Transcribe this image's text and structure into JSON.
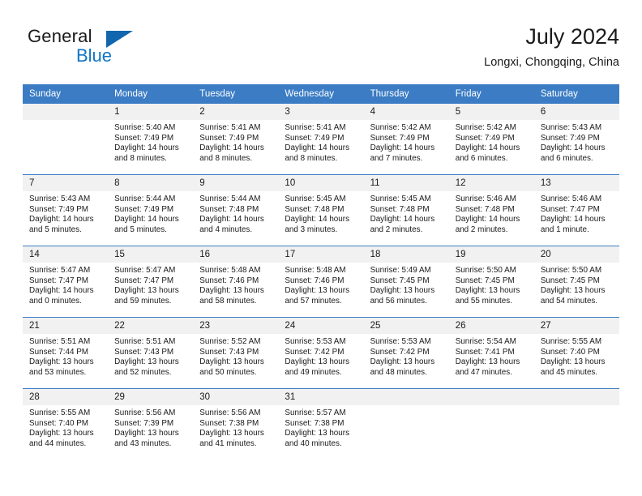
{
  "brand": {
    "name_part1": "General",
    "name_part2": "Blue",
    "triangle_icon": "triangle-icon",
    "accent_color": "#1166ad"
  },
  "header": {
    "title": "July 2024",
    "location": "Longxi, Chongqing, China",
    "header_bg_color": "#3b7cc4",
    "daynum_bg_color": "#f1f1f1"
  },
  "weekday_headers": [
    "Sunday",
    "Monday",
    "Tuesday",
    "Wednesday",
    "Thursday",
    "Friday",
    "Saturday"
  ],
  "weeks": [
    [
      {
        "day": "",
        "sunrise": "",
        "sunset": "",
        "daylight": ""
      },
      {
        "day": "1",
        "sunrise": "Sunrise: 5:40 AM",
        "sunset": "Sunset: 7:49 PM",
        "daylight": "Daylight: 14 hours and 8 minutes."
      },
      {
        "day": "2",
        "sunrise": "Sunrise: 5:41 AM",
        "sunset": "Sunset: 7:49 PM",
        "daylight": "Daylight: 14 hours and 8 minutes."
      },
      {
        "day": "3",
        "sunrise": "Sunrise: 5:41 AM",
        "sunset": "Sunset: 7:49 PM",
        "daylight": "Daylight: 14 hours and 8 minutes."
      },
      {
        "day": "4",
        "sunrise": "Sunrise: 5:42 AM",
        "sunset": "Sunset: 7:49 PM",
        "daylight": "Daylight: 14 hours and 7 minutes."
      },
      {
        "day": "5",
        "sunrise": "Sunrise: 5:42 AM",
        "sunset": "Sunset: 7:49 PM",
        "daylight": "Daylight: 14 hours and 6 minutes."
      },
      {
        "day": "6",
        "sunrise": "Sunrise: 5:43 AM",
        "sunset": "Sunset: 7:49 PM",
        "daylight": "Daylight: 14 hours and 6 minutes."
      }
    ],
    [
      {
        "day": "7",
        "sunrise": "Sunrise: 5:43 AM",
        "sunset": "Sunset: 7:49 PM",
        "daylight": "Daylight: 14 hours and 5 minutes."
      },
      {
        "day": "8",
        "sunrise": "Sunrise: 5:44 AM",
        "sunset": "Sunset: 7:49 PM",
        "daylight": "Daylight: 14 hours and 5 minutes."
      },
      {
        "day": "9",
        "sunrise": "Sunrise: 5:44 AM",
        "sunset": "Sunset: 7:48 PM",
        "daylight": "Daylight: 14 hours and 4 minutes."
      },
      {
        "day": "10",
        "sunrise": "Sunrise: 5:45 AM",
        "sunset": "Sunset: 7:48 PM",
        "daylight": "Daylight: 14 hours and 3 minutes."
      },
      {
        "day": "11",
        "sunrise": "Sunrise: 5:45 AM",
        "sunset": "Sunset: 7:48 PM",
        "daylight": "Daylight: 14 hours and 2 minutes."
      },
      {
        "day": "12",
        "sunrise": "Sunrise: 5:46 AM",
        "sunset": "Sunset: 7:48 PM",
        "daylight": "Daylight: 14 hours and 2 minutes."
      },
      {
        "day": "13",
        "sunrise": "Sunrise: 5:46 AM",
        "sunset": "Sunset: 7:47 PM",
        "daylight": "Daylight: 14 hours and 1 minute."
      }
    ],
    [
      {
        "day": "14",
        "sunrise": "Sunrise: 5:47 AM",
        "sunset": "Sunset: 7:47 PM",
        "daylight": "Daylight: 14 hours and 0 minutes."
      },
      {
        "day": "15",
        "sunrise": "Sunrise: 5:47 AM",
        "sunset": "Sunset: 7:47 PM",
        "daylight": "Daylight: 13 hours and 59 minutes."
      },
      {
        "day": "16",
        "sunrise": "Sunrise: 5:48 AM",
        "sunset": "Sunset: 7:46 PM",
        "daylight": "Daylight: 13 hours and 58 minutes."
      },
      {
        "day": "17",
        "sunrise": "Sunrise: 5:48 AM",
        "sunset": "Sunset: 7:46 PM",
        "daylight": "Daylight: 13 hours and 57 minutes."
      },
      {
        "day": "18",
        "sunrise": "Sunrise: 5:49 AM",
        "sunset": "Sunset: 7:45 PM",
        "daylight": "Daylight: 13 hours and 56 minutes."
      },
      {
        "day": "19",
        "sunrise": "Sunrise: 5:50 AM",
        "sunset": "Sunset: 7:45 PM",
        "daylight": "Daylight: 13 hours and 55 minutes."
      },
      {
        "day": "20",
        "sunrise": "Sunrise: 5:50 AM",
        "sunset": "Sunset: 7:45 PM",
        "daylight": "Daylight: 13 hours and 54 minutes."
      }
    ],
    [
      {
        "day": "21",
        "sunrise": "Sunrise: 5:51 AM",
        "sunset": "Sunset: 7:44 PM",
        "daylight": "Daylight: 13 hours and 53 minutes."
      },
      {
        "day": "22",
        "sunrise": "Sunrise: 5:51 AM",
        "sunset": "Sunset: 7:43 PM",
        "daylight": "Daylight: 13 hours and 52 minutes."
      },
      {
        "day": "23",
        "sunrise": "Sunrise: 5:52 AM",
        "sunset": "Sunset: 7:43 PM",
        "daylight": "Daylight: 13 hours and 50 minutes."
      },
      {
        "day": "24",
        "sunrise": "Sunrise: 5:53 AM",
        "sunset": "Sunset: 7:42 PM",
        "daylight": "Daylight: 13 hours and 49 minutes."
      },
      {
        "day": "25",
        "sunrise": "Sunrise: 5:53 AM",
        "sunset": "Sunset: 7:42 PM",
        "daylight": "Daylight: 13 hours and 48 minutes."
      },
      {
        "day": "26",
        "sunrise": "Sunrise: 5:54 AM",
        "sunset": "Sunset: 7:41 PM",
        "daylight": "Daylight: 13 hours and 47 minutes."
      },
      {
        "day": "27",
        "sunrise": "Sunrise: 5:55 AM",
        "sunset": "Sunset: 7:40 PM",
        "daylight": "Daylight: 13 hours and 45 minutes."
      }
    ],
    [
      {
        "day": "28",
        "sunrise": "Sunrise: 5:55 AM",
        "sunset": "Sunset: 7:40 PM",
        "daylight": "Daylight: 13 hours and 44 minutes."
      },
      {
        "day": "29",
        "sunrise": "Sunrise: 5:56 AM",
        "sunset": "Sunset: 7:39 PM",
        "daylight": "Daylight: 13 hours and 43 minutes."
      },
      {
        "day": "30",
        "sunrise": "Sunrise: 5:56 AM",
        "sunset": "Sunset: 7:38 PM",
        "daylight": "Daylight: 13 hours and 41 minutes."
      },
      {
        "day": "31",
        "sunrise": "Sunrise: 5:57 AM",
        "sunset": "Sunset: 7:38 PM",
        "daylight": "Daylight: 13 hours and 40 minutes."
      },
      {
        "day": "",
        "sunrise": "",
        "sunset": "",
        "daylight": ""
      },
      {
        "day": "",
        "sunrise": "",
        "sunset": "",
        "daylight": ""
      },
      {
        "day": "",
        "sunrise": "",
        "sunset": "",
        "daylight": ""
      }
    ]
  ]
}
